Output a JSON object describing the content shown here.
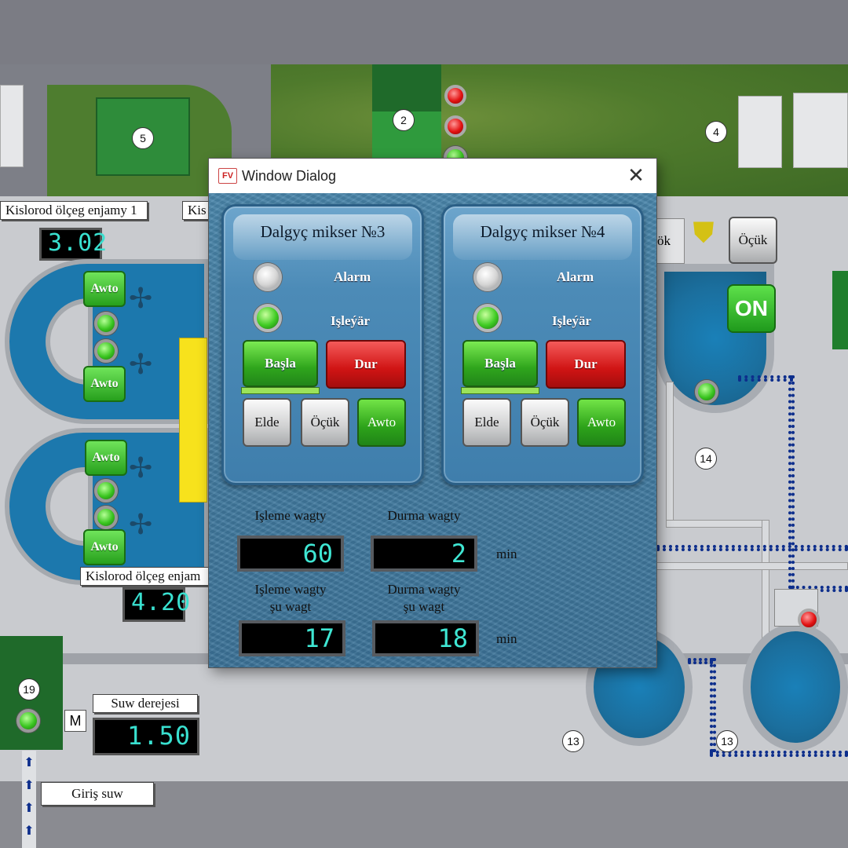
{
  "scene": {
    "badges": [
      "5",
      "2",
      "4",
      "14",
      "19",
      "13",
      "13"
    ],
    "oxygen_meter_1_label": "Kislorod ölçeg enjamy 1",
    "oxygen_meter_2_label_partial": "Kis",
    "oxygen_meter_3_label": "Kislorod ölçeg enjam",
    "oxygen_value_1": "3.02",
    "oxygen_value_2": "4.20",
    "water_level_label": "Suw derejesi",
    "water_level_value": "1.50",
    "water_in_label": "Giriş suw",
    "motor_label": "M",
    "awto_label": "Awto",
    "right_ocuk_partial": "ök",
    "right_ocuk": "Öçük",
    "on_button": "ON"
  },
  "dialog": {
    "app_icon": "FV",
    "title": "Window Dialog",
    "close_symbol": "✕",
    "mixers": [
      {
        "title": "Dalgyç mikser №3",
        "alarm_label": "Alarm",
        "running_label": "Işleýär",
        "start_label": "Başla",
        "stop_label": "Dur",
        "manual_label": "Elde",
        "off_label": "Öçük",
        "auto_label": "Awto"
      },
      {
        "title": "Dalgyç mikser №4",
        "alarm_label": "Alarm",
        "running_label": "Işleýär",
        "start_label": "Başla",
        "stop_label": "Dur",
        "manual_label": "Elde",
        "off_label": "Öçük",
        "auto_label": "Awto"
      }
    ],
    "work_time_label": "Işleme wagty",
    "stop_time_label": "Durma wagty",
    "work_time_value": "60",
    "stop_time_value": "2",
    "work_time_now_label_1": "Işleme wagty",
    "work_time_now_label_2": "şu wagt",
    "stop_time_now_label_1": "Durma wagty",
    "stop_time_now_label_2": "şu wagt",
    "work_time_now_value": "17",
    "stop_time_now_value": "18",
    "unit": "min"
  },
  "colors": {
    "accent_green": "#2fa51c",
    "stop_red": "#d01414",
    "lcd_text": "#3fe6d3"
  }
}
